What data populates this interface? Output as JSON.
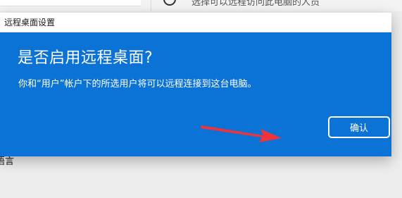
{
  "background": {
    "partial_text_top": "选择可以远程访问此电脑的人员",
    "partial_text_left": "语言"
  },
  "dialog": {
    "title": "远程桌面设置",
    "heading": "是否启用远程桌面?",
    "description": "你和“用户”帐户下的所选用户将可以远程连接到这台电脑。",
    "confirm_label": "确认"
  },
  "annotation": {
    "arrow_color": "#f0333a"
  },
  "colors": {
    "dialog_blue": "#0b72d6",
    "titlebar_bg": "#ffffff"
  }
}
